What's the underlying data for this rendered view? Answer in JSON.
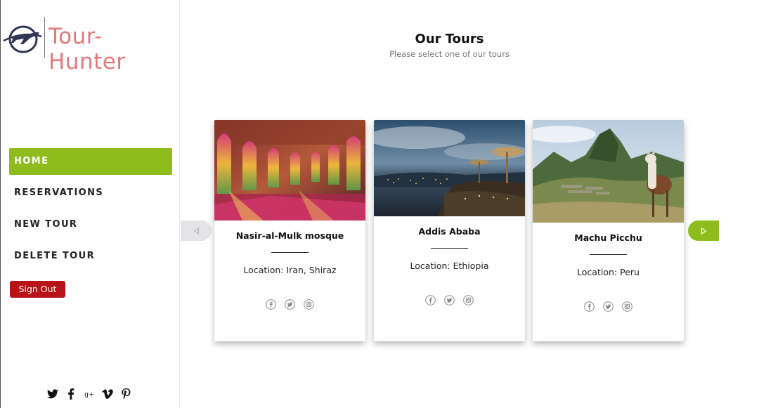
{
  "brand": {
    "name": "Tour-Hunter",
    "color": "#e27a7a"
  },
  "nav": {
    "items": [
      {
        "label": "HOME",
        "active": true
      },
      {
        "label": "RESERVATIONS",
        "active": false
      },
      {
        "label": "NEW TOUR",
        "active": false
      },
      {
        "label": "DELETE TOUR",
        "active": false
      }
    ],
    "accent": "#8ebc1c"
  },
  "signout": {
    "label": "Sign Out",
    "color": "#b81417"
  },
  "sidebar_social": [
    "twitter-icon",
    "facebook-icon",
    "google-plus-icon",
    "vimeo-icon",
    "pinterest-icon"
  ],
  "header": {
    "title": "Our Tours",
    "subtitle": "Please select one of our tours"
  },
  "tours": [
    {
      "name": "Nasir-al-Mulk mosque",
      "location": "Location: Iran, Shiraz",
      "image": "mosque interior with stained glass windows"
    },
    {
      "name": "Addis Ababa",
      "location": "Location: Ethiopia",
      "image": "city skyline at dusk"
    },
    {
      "name": "Machu Picchu",
      "location": "Location: Peru",
      "image": "mountain ruins with llama"
    }
  ],
  "card_social": [
    "facebook-icon",
    "twitter-icon",
    "instagram-icon"
  ],
  "carousel": {
    "prev": "left-arrow-icon",
    "next": "right-arrow-icon"
  }
}
